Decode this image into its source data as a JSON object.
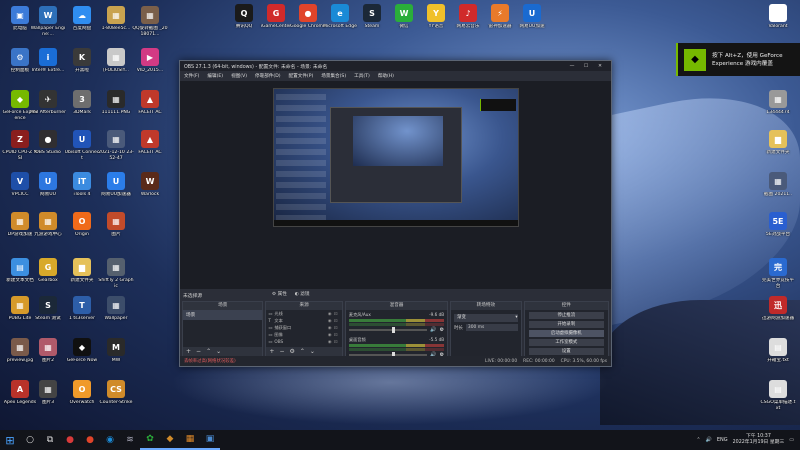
{
  "desktop": {
    "icons": [
      {
        "label": "此电脑",
        "color": "#3c7bd9",
        "glyph": "▣"
      },
      {
        "label": "Wallpaper Engine:...",
        "color": "#2d6fb8",
        "glyph": "W"
      },
      {
        "label": "百度网盘",
        "color": "#2f8df0",
        "glyph": "☁"
      },
      {
        "label": "1-808ee5c...",
        "color": "#c9a34f",
        "glyph": "▦"
      },
      {
        "label": "QQ旋转截图 _2018071...",
        "color": "#7a5f4a",
        "glyph": "▦"
      },
      {
        "label": "控制面板",
        "color": "#3a74c7",
        "glyph": "⚙"
      },
      {
        "label": "Intel® Extre...",
        "color": "#1a6dd6",
        "glyph": "i"
      },
      {
        "label": "开黑啦",
        "color": "#3a3a3a",
        "glyph": "K"
      },
      {
        "label": "[FOLIUSIY...",
        "color": "#c9c9c9",
        "glyph": "▦"
      },
      {
        "label": "VID_2015...",
        "color": "#d23a84",
        "glyph": "▶"
      },
      {
        "label": "GeForce Experience",
        "color": "#76b900",
        "glyph": "◆"
      },
      {
        "label": "MSI Afterburner",
        "color": "#333333",
        "glyph": "✈"
      },
      {
        "label": "3DMark",
        "color": "#6e6e6e",
        "glyph": "3"
      },
      {
        "label": "111111.PNG",
        "color": "#2a2a2a",
        "glyph": "▦"
      },
      {
        "label": "FACEIT AC",
        "color": "#c0392b",
        "glyph": "▲"
      },
      {
        "label": "CPUID CPU-Z MSI",
        "color": "#8a1e1e",
        "glyph": "Z"
      },
      {
        "label": "OBS Studio",
        "color": "#302e31",
        "glyph": "●"
      },
      {
        "label": "Ubisoft Connect",
        "color": "#2154b8",
        "glyph": "U"
      },
      {
        "label": "2021-12-10 23-52-47",
        "color": "#4a5a7a",
        "glyph": "▦"
      },
      {
        "label": "FACEIT AC",
        "color": "#c0392b",
        "glyph": "▲"
      },
      {
        "label": "VPCICC",
        "color": "#1e4fa8",
        "glyph": "V"
      },
      {
        "label": "网易UU",
        "color": "#2d77e0",
        "glyph": "U"
      },
      {
        "label": "iTools 4",
        "color": "#3b8be0",
        "glyph": "iT"
      },
      {
        "label": "网易UU加速器",
        "color": "#2b7de9",
        "glyph": "U"
      },
      {
        "label": "Warlock",
        "color": "#5a2a1a",
        "glyph": "W"
      },
      {
        "label": "DP游戏加速",
        "color": "#d08b2a",
        "glyph": "▦"
      },
      {
        "label": "九游游戏中心",
        "color": "#d08b2a",
        "glyph": "▦"
      },
      {
        "label": "Origin",
        "color": "#f06a1a",
        "glyph": "O"
      },
      {
        "label": "图片",
        "color": "#c24b2a",
        "glyph": "▦"
      },
      {
        "label": "新建文本文档",
        "color": "#3c8fe0",
        "glyph": "▤"
      },
      {
        "label": "Gearbox",
        "color": "#d8a92a",
        "glyph": "G"
      },
      {
        "label": "新建文件夹",
        "color": "#e5c15a",
        "glyph": "▆"
      },
      {
        "label": "ShiftTy 2 Graphic",
        "color": "#55606e",
        "glyph": "▦"
      },
      {
        "label": "PUBG Lite",
        "color": "#d69a2a",
        "glyph": "▦"
      },
      {
        "label": "Steam 测试",
        "color": "#1b2838",
        "glyph": "S"
      },
      {
        "label": "1 ts3server",
        "color": "#2d5ea8",
        "glyph": "T"
      },
      {
        "label": "Wallpaper",
        "color": "#3c4d6a",
        "glyph": "▦"
      },
      {
        "label": "preview.jpg",
        "color": "#7a5a4a",
        "glyph": "▦"
      },
      {
        "label": "图片2",
        "color": "#b05a6a",
        "glyph": "▦"
      },
      {
        "label": "GeForce Now",
        "color": "#101010",
        "glyph": "◆"
      },
      {
        "label": "MW",
        "color": "#2a2a2a",
        "glyph": "M"
      },
      {
        "label": "Apex Legends",
        "color": "#b8322a",
        "glyph": "A"
      },
      {
        "label": "图片3",
        "color": "#444",
        "glyph": "▦"
      },
      {
        "label": "Overwatch",
        "color": "#f09a2a",
        "glyph": "O"
      },
      {
        "label": "Counter-Strike",
        "color": "#d08b2a",
        "glyph": "CS"
      },
      {
        "label": "Valorant",
        "color": "#ffffff",
        "glyph": "V"
      },
      {
        "label": "13444474",
        "color": "#999999",
        "glyph": "▦"
      },
      {
        "label": "新建文件夹",
        "color": "#e5c15a",
        "glyph": "▆"
      },
      {
        "label": "截图 20211..",
        "color": "#4a5a7a",
        "glyph": "▦"
      },
      {
        "label": "5E对战平台",
        "color": "#2a5fd0",
        "glyph": "5E"
      },
      {
        "label": "完美世界竞技平台",
        "color": "#2a6ad0",
        "glyph": "完"
      },
      {
        "label": "迅游网游加速器",
        "color": "#c02a2a",
        "glyph": "迅"
      },
      {
        "label": "开箱宝.txt",
        "color": "#dddddd",
        "glyph": "▤"
      },
      {
        "label": "CSGO菜单描述.txt",
        "color": "#dddddd",
        "glyph": "▤"
      },
      {
        "label": "CSGO准星参数.txt",
        "color": "#dddddd",
        "glyph": "▤"
      },
      {
        "label": "回收站",
        "color": "#9ab0cc",
        "glyph": "♻"
      }
    ]
  },
  "notification": {
    "line1": "按下 Alt+Z，使用 GeForce",
    "line2": "Experience 游戏内覆盖"
  },
  "obs": {
    "title": "OBS 27.1.3 (64-bit, windows) - 配置文件: 未命名 - 场景: 未命名",
    "menu": [
      "文件(F)",
      "编辑(E)",
      "视图(V)",
      "停靠部件(D)",
      "配置文件(P)",
      "场景集合(S)",
      "工具(T)",
      "帮助(H)"
    ],
    "scene_label": "未选择源",
    "preview_tools": [
      "属性",
      "滤镜"
    ],
    "docks": {
      "scenes_title": "场景",
      "sources_title": "来源",
      "mixer_title": "混音器",
      "transitions_title": "转场特效",
      "controls_title": "控件"
    },
    "scenes": [
      "场景"
    ],
    "sources": [
      {
        "icon": "▭",
        "name": "光线"
      },
      {
        "icon": "T",
        "name": "文本"
      },
      {
        "icon": "▭",
        "name": "捕获窗口"
      },
      {
        "icon": "▭",
        "name": "图像"
      },
      {
        "icon": "▭",
        "name": "OBS"
      },
      {
        "icon": "T",
        "name": "捕获游戏文本"
      },
      {
        "icon": "▭",
        "name": "捕获"
      },
      {
        "icon": "▭",
        "name": "捕获 2"
      },
      {
        "icon": "▭",
        "name": "浏览器"
      }
    ],
    "mixer": [
      {
        "name": "麦克风/Aux",
        "db": "-9.6 dB"
      },
      {
        "name": "桌面音频",
        "db": "-5.5 dB"
      }
    ],
    "transition": {
      "selected": "渐变",
      "duration_label": "时长",
      "duration_value": "300 ms"
    },
    "controls": [
      "停止推流",
      "开始录制",
      "启动虚拟摄像机",
      "工作室模式",
      "设置",
      "退出"
    ],
    "status": {
      "warning": "丢帧率过高(网络状况较差)",
      "live": "LIVE: 00:00:00",
      "rec": "REC: 00:00:00",
      "cpu": "CPU: 3.5%, 60.00 fps"
    }
  },
  "taskbar": {
    "time": "下午 10:37",
    "date": "2022年1月19日 星期三",
    "ime": "ENG",
    "apps": [
      "○",
      "⧉",
      "●",
      "●",
      "◉",
      "≋",
      "✿",
      "◆",
      "▦",
      "▣"
    ]
  }
}
